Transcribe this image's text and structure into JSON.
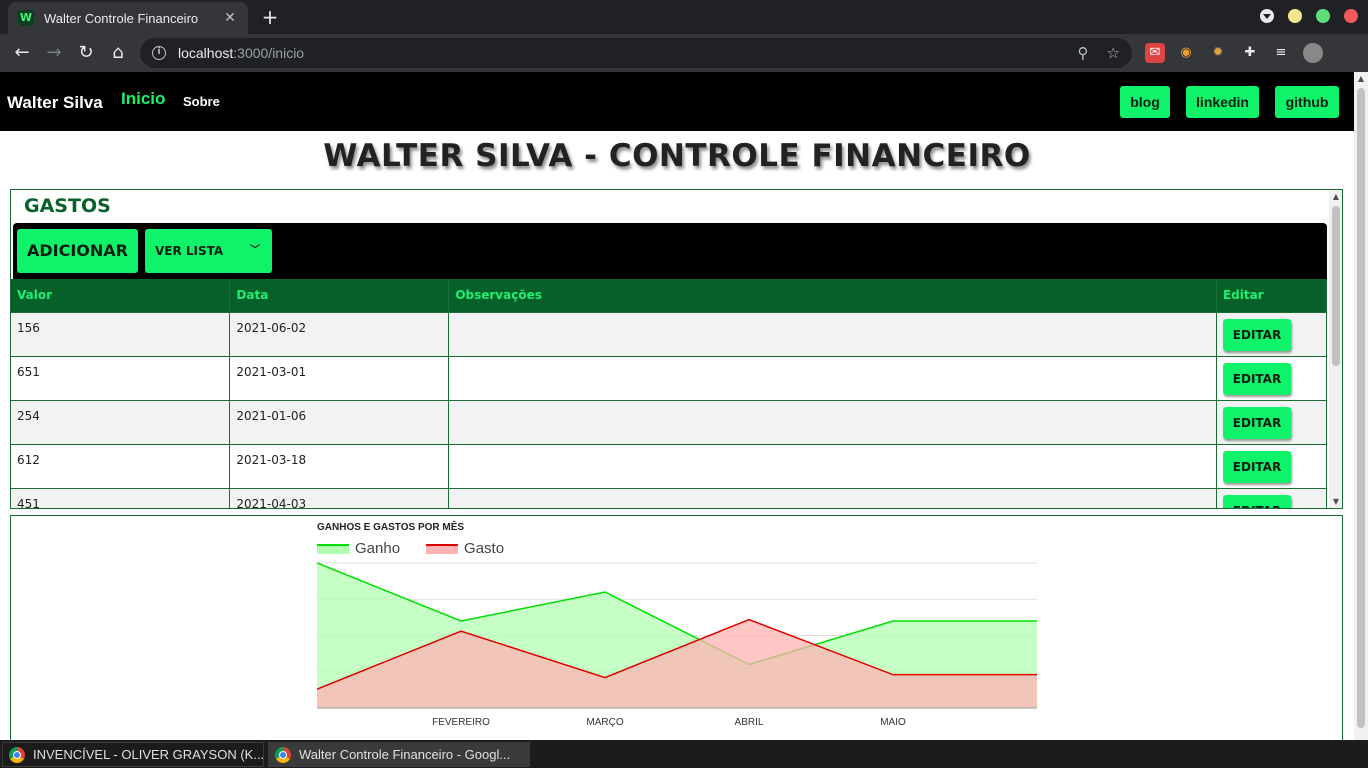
{
  "browser": {
    "tab_title": "Walter Controle Financeiro",
    "tab_favicon": "W",
    "tab_close": "✕",
    "new_tab": "+",
    "url_host": "localhost",
    "url_path": ":3000/inicio"
  },
  "nav": {
    "brand": "Walter Silva",
    "inicio": "Inicio",
    "sobre": "Sobre",
    "blog": "blog",
    "linkedin": "linkedin",
    "github": "github"
  },
  "page": {
    "title": "WALTER SILVA - CONTROLE FINANCEIRO"
  },
  "gastos": {
    "title": "GASTOS",
    "add_label": "ADICIONAR",
    "list_label": "VER LISTA",
    "columns": [
      "Valor",
      "Data",
      "Observações",
      "Editar"
    ],
    "edit_label": "EDITAR",
    "rows": [
      {
        "valor": "156",
        "data": "2021-06-02",
        "obs": ""
      },
      {
        "valor": "651",
        "data": "2021-03-01",
        "obs": ""
      },
      {
        "valor": "254",
        "data": "2021-01-06",
        "obs": ""
      },
      {
        "valor": "612",
        "data": "2021-03-18",
        "obs": ""
      },
      {
        "valor": "451",
        "data": "2021-04-03",
        "obs": ""
      }
    ]
  },
  "chart_data": {
    "type": "area",
    "title": "GANHOS E GASTOS POR MÊS",
    "categories": [
      "",
      "FEVEREIRO",
      "MARÇO",
      "ABRIL",
      "MAIO",
      ""
    ],
    "series": [
      {
        "name": "Ganho",
        "color": "#00e000",
        "fill": "#b3ffb3",
        "values": [
          100,
          60,
          80,
          30,
          60,
          60
        ]
      },
      {
        "name": "Gasto",
        "color": "#e00000",
        "fill": "#ffb3b3",
        "values": [
          13,
          53,
          21,
          61,
          23,
          23
        ]
      }
    ],
    "ylim": [
      0,
      100
    ],
    "grid": true,
    "legend": "top-left"
  },
  "taskbar": {
    "items": [
      "INVENCÍVEL - OLIVER GRAYSON (K...",
      "Walter Controle Financeiro - Googl..."
    ]
  }
}
